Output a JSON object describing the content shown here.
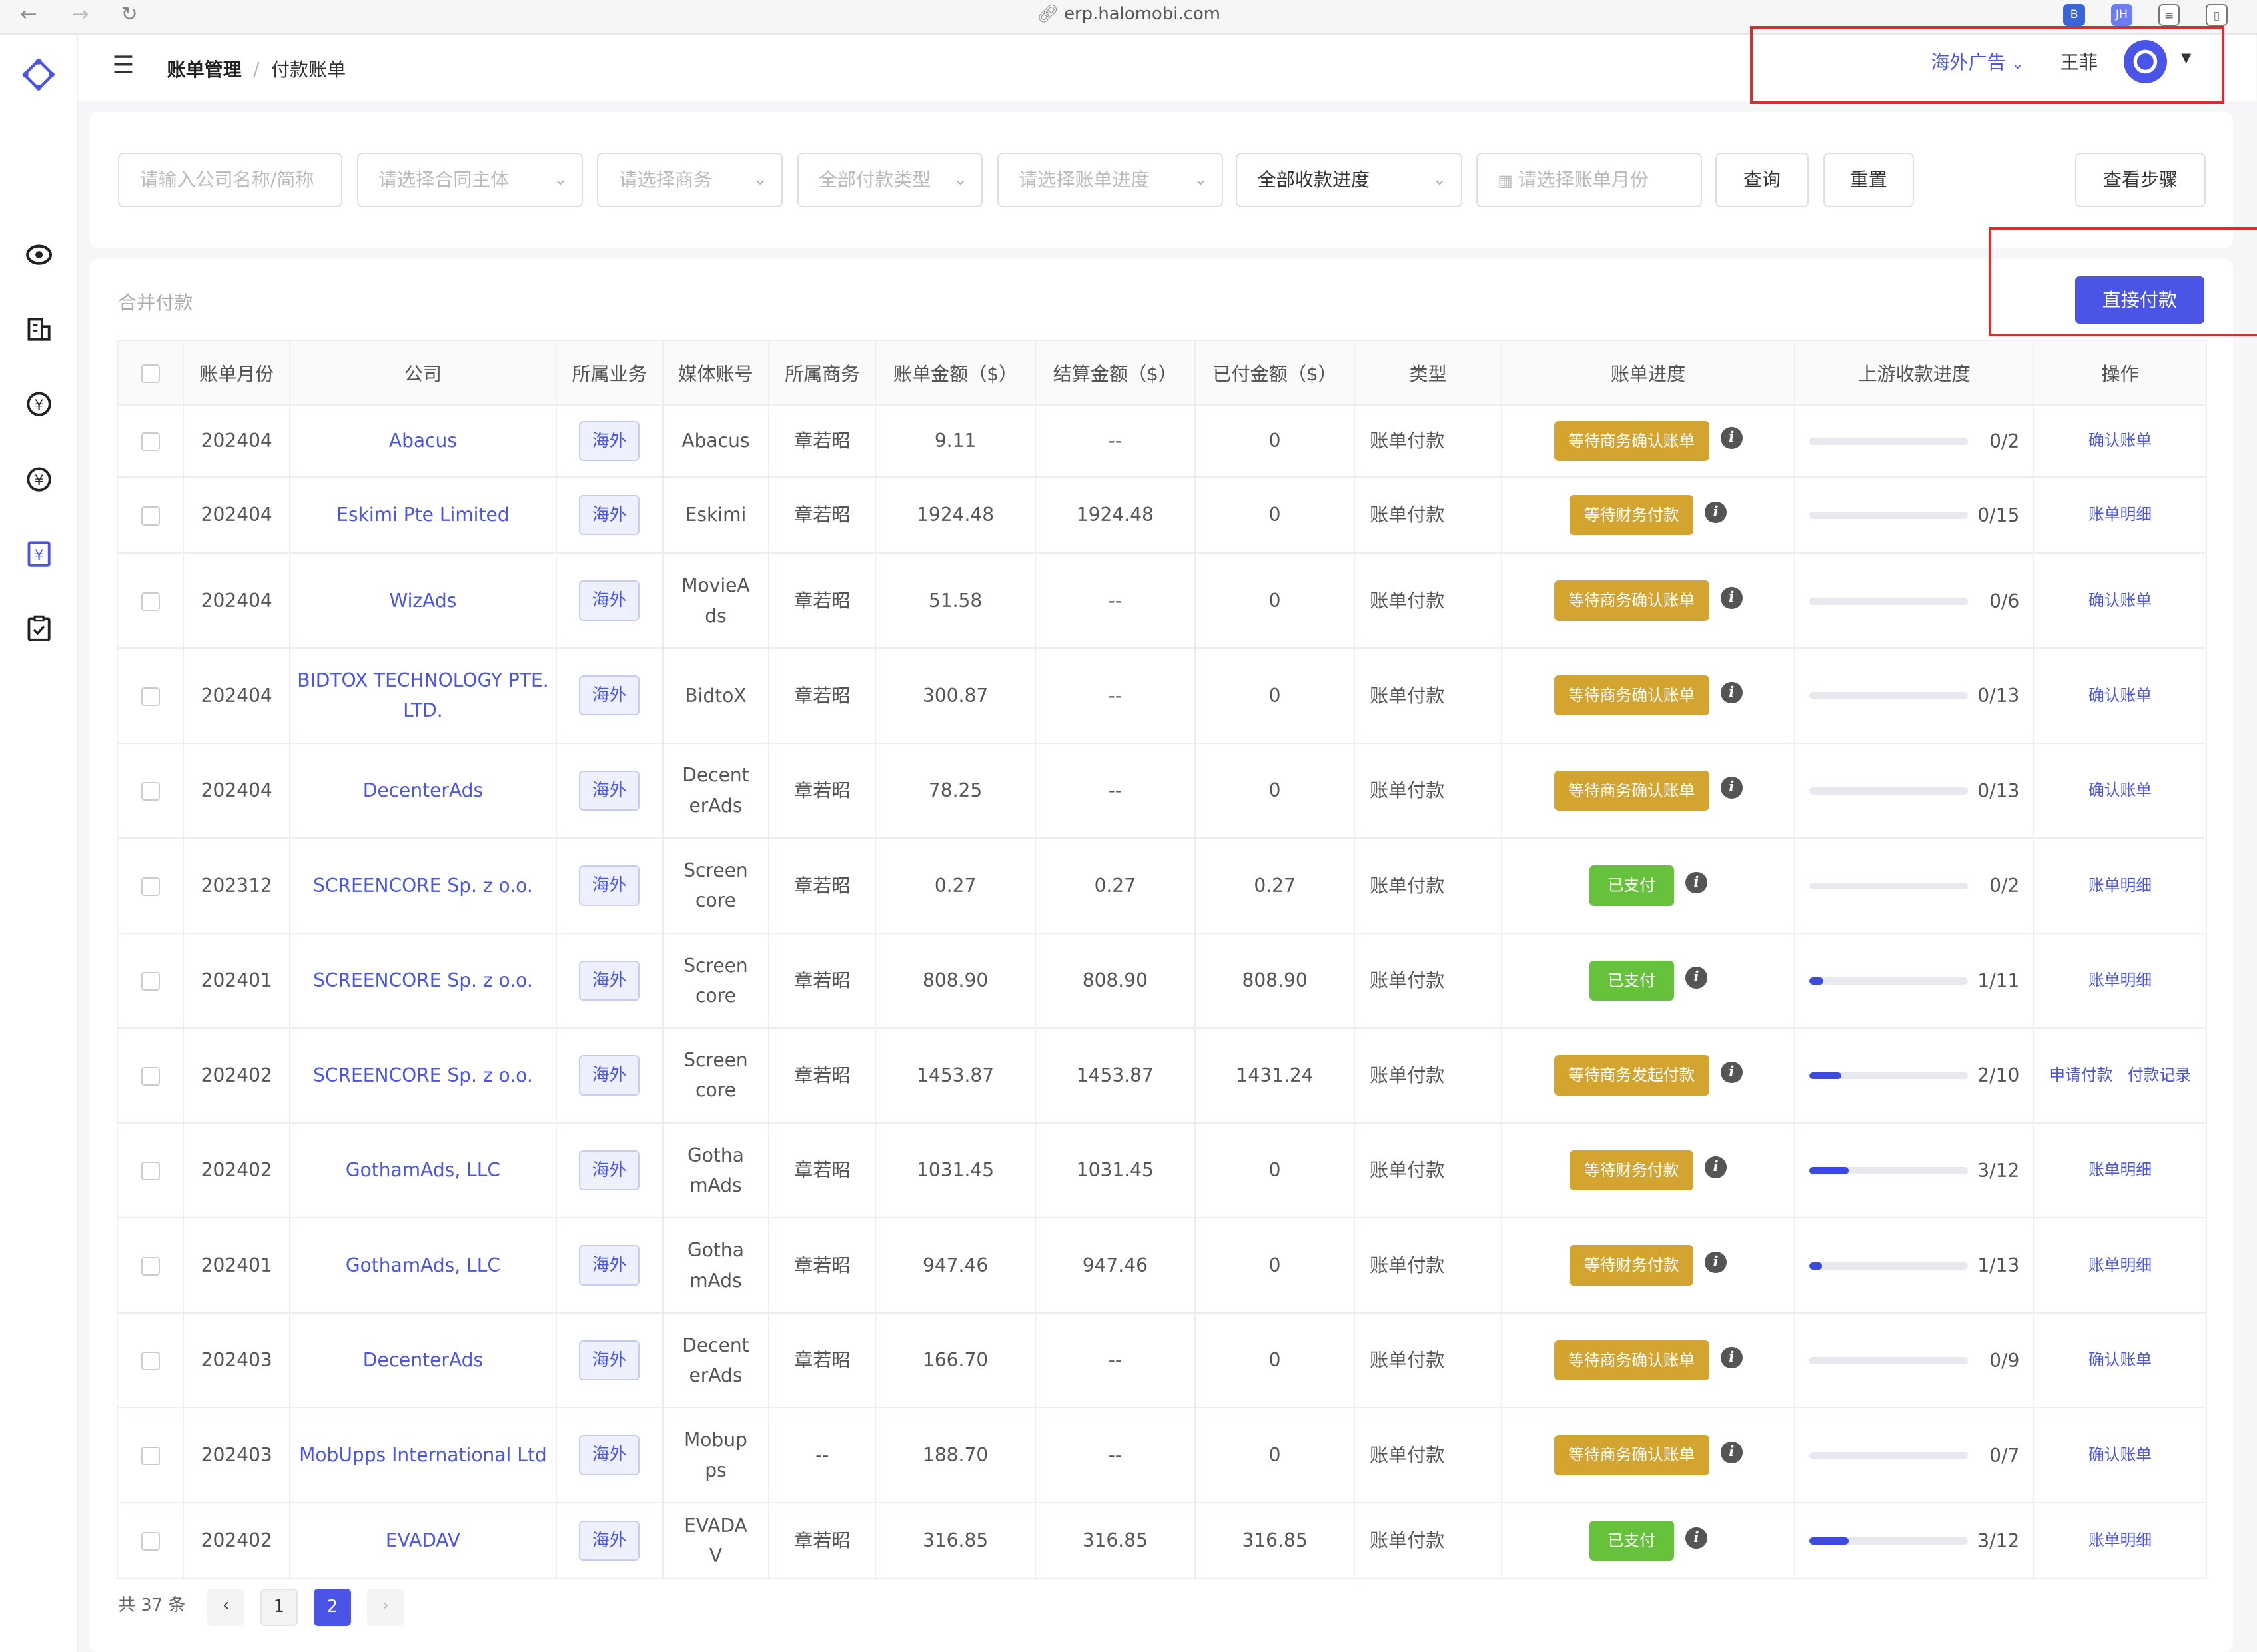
{
  "browser": {
    "url": "erp.halomobi.com"
  },
  "breadcrumb": {
    "first": "账单管理",
    "sep": "/",
    "current": "付款账单"
  },
  "header": {
    "business": "海外广告",
    "user": "王菲"
  },
  "filters": {
    "company_placeholder": "请输入公司名称/简称",
    "contract_placeholder": "请选择合同主体",
    "sales_placeholder": "请选择商务",
    "paytype_placeholder": "全部付款类型",
    "billprogress_placeholder": "请选择账单进度",
    "receive_progress": "全部收款进度",
    "month_placeholder": "请选择账单月份",
    "query": "查询",
    "reset": "重置",
    "steps": "查看步骤"
  },
  "panel": {
    "title": "合并付款",
    "pay_button": "直接付款"
  },
  "table": {
    "headers": [
      "账单月份",
      "公司",
      "所属业务",
      "媒体账号",
      "所属商务",
      "账单金额（$）",
      "结算金额（$）",
      "已付金额（$）",
      "类型",
      "账单进度",
      "上游收款进度",
      "操作"
    ],
    "rows": [
      {
        "month": "202404",
        "company": "Abacus",
        "biz": "海外",
        "media": "Abacus",
        "sales": "章若昭",
        "amount": "9.11",
        "settle": "--",
        "paid": "0",
        "type": "账单付款",
        "status": "等待商务确认账单",
        "status_kind": "wait",
        "progress": 0,
        "progress_text": "0/2",
        "ops": "确认账单"
      },
      {
        "month": "202404",
        "company": "Eskimi Pte Limited",
        "biz": "海外",
        "media": "Eskimi",
        "sales": "章若昭",
        "amount": "1924.48",
        "settle": "1924.48",
        "paid": "0",
        "type": "账单付款",
        "status": "等待财务付款",
        "status_kind": "wait",
        "progress": 0,
        "progress_text": "0/15",
        "ops": "账单明细"
      },
      {
        "month": "202404",
        "company": "WizAds",
        "biz": "海外",
        "media": "MovieAds",
        "sales": "章若昭",
        "amount": "51.58",
        "settle": "--",
        "paid": "0",
        "type": "账单付款",
        "status": "等待商务确认账单",
        "status_kind": "wait",
        "progress": 0,
        "progress_text": "0/6",
        "ops": "确认账单"
      },
      {
        "month": "202404",
        "company": "BIDTOX TECHNOLOGY PTE. LTD.",
        "biz": "海外",
        "media": "BidtoX",
        "sales": "章若昭",
        "amount": "300.87",
        "settle": "--",
        "paid": "0",
        "type": "账单付款",
        "status": "等待商务确认账单",
        "status_kind": "wait",
        "progress": 0,
        "progress_text": "0/13",
        "ops": "确认账单"
      },
      {
        "month": "202404",
        "company": "DecenterAds",
        "biz": "海外",
        "media": "DecenterAds",
        "sales": "章若昭",
        "amount": "78.25",
        "settle": "--",
        "paid": "0",
        "type": "账单付款",
        "status": "等待商务确认账单",
        "status_kind": "wait",
        "progress": 0,
        "progress_text": "0/13",
        "ops": "确认账单"
      },
      {
        "month": "202312",
        "company": "SCREENCORE Sp. z o.o.",
        "biz": "海外",
        "media": "Screencore",
        "sales": "章若昭",
        "amount": "0.27",
        "settle": "0.27",
        "paid": "0.27",
        "type": "账单付款",
        "status": "已支付",
        "status_kind": "paid",
        "progress": 0,
        "progress_text": "0/2",
        "ops": "账单明细"
      },
      {
        "month": "202401",
        "company": "SCREENCORE Sp. z o.o.",
        "biz": "海外",
        "media": "Screencore",
        "sales": "章若昭",
        "amount": "808.90",
        "settle": "808.90",
        "paid": "808.90",
        "type": "账单付款",
        "status": "已支付",
        "status_kind": "paid",
        "progress": 0.0909,
        "progress_text": "1/11",
        "ops": "账单明细"
      },
      {
        "month": "202402",
        "company": "SCREENCORE Sp. z o.o.",
        "biz": "海外",
        "media": "Screencore",
        "sales": "章若昭",
        "amount": "1453.87",
        "settle": "1453.87",
        "paid": "1431.24",
        "type": "账单付款",
        "status": "等待商务发起付款",
        "status_kind": "wait",
        "progress": 0.2,
        "progress_text": "2/10",
        "ops": "申请付款   付款记录"
      },
      {
        "month": "202402",
        "company": "GothamAds, LLC",
        "biz": "海外",
        "media": "GothamAds",
        "sales": "章若昭",
        "amount": "1031.45",
        "settle": "1031.45",
        "paid": "0",
        "type": "账单付款",
        "status": "等待财务付款",
        "status_kind": "wait",
        "progress": 0.25,
        "progress_text": "3/12",
        "ops": "账单明细"
      },
      {
        "month": "202401",
        "company": "GothamAds, LLC",
        "biz": "海外",
        "media": "GothamAds",
        "sales": "章若昭",
        "amount": "947.46",
        "settle": "947.46",
        "paid": "0",
        "type": "账单付款",
        "status": "等待财务付款",
        "status_kind": "wait",
        "progress": 0.0769,
        "progress_text": "1/13",
        "ops": "账单明细"
      },
      {
        "month": "202403",
        "company": "DecenterAds",
        "biz": "海外",
        "media": "DecenterAds",
        "sales": "章若昭",
        "amount": "166.70",
        "settle": "--",
        "paid": "0",
        "type": "账单付款",
        "status": "等待商务确认账单",
        "status_kind": "wait",
        "progress": 0,
        "progress_text": "0/9",
        "ops": "确认账单"
      },
      {
        "month": "202403",
        "company": "MobUpps International Ltd",
        "biz": "海外",
        "media": "Mobupps",
        "sales": "--",
        "amount": "188.70",
        "settle": "--",
        "paid": "0",
        "type": "账单付款",
        "status": "等待商务确认账单",
        "status_kind": "wait",
        "progress": 0,
        "progress_text": "0/7",
        "ops": "确认账单"
      },
      {
        "month": "202402",
        "company": "EVADAV",
        "biz": "海外",
        "media": "EVADAV",
        "sales": "章若昭",
        "amount": "316.85",
        "settle": "316.85",
        "paid": "316.85",
        "type": "账单付款",
        "status": "已支付",
        "status_kind": "paid",
        "progress": 0.25,
        "progress_text": "3/12",
        "ops": "账单明细"
      }
    ]
  },
  "pagination": {
    "total": "共 37 条",
    "pages": [
      "1",
      "2"
    ],
    "current": "2",
    "prev": "‹",
    "next": "›"
  },
  "colors": {
    "accent": "#4a55e8",
    "wait": "#d4a431",
    "paid": "#66c23a",
    "annotation": "#e12b2b"
  }
}
